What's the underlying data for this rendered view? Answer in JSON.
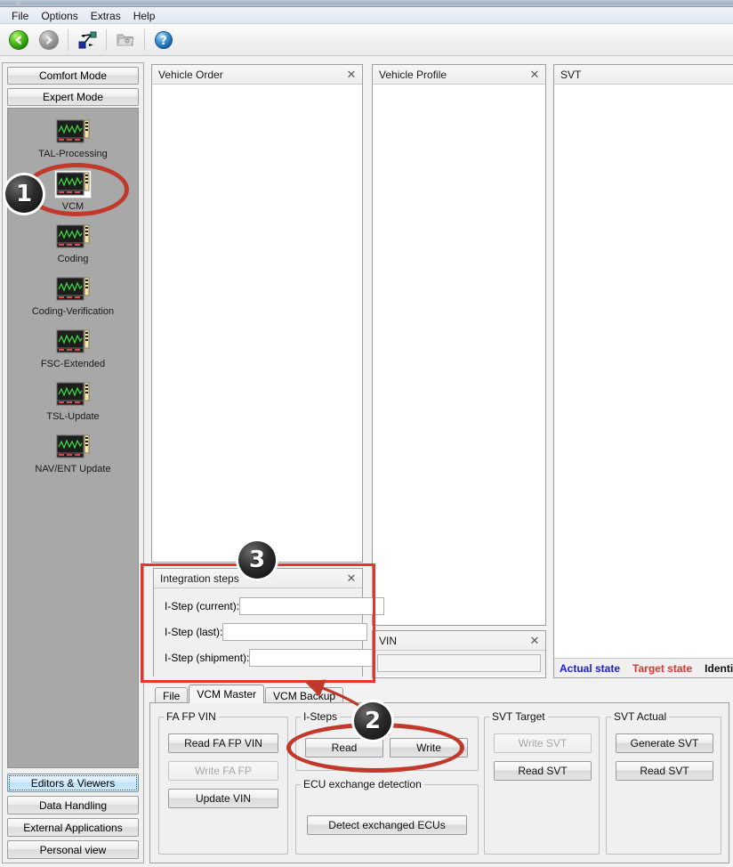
{
  "window": {
    "menu": [
      "File",
      "Options",
      "Extras",
      "Help"
    ],
    "toolbar": [
      {
        "name": "back-icon",
        "label": "Back",
        "enabled": true
      },
      {
        "name": "forward-icon",
        "label": "Forward",
        "enabled": false
      },
      {
        "name": "connection-icon",
        "label": "Connection",
        "enabled": true
      },
      {
        "name": "folder-icon",
        "label": "Open",
        "enabled": true
      },
      {
        "name": "help-icon",
        "label": "Help",
        "enabled": true
      }
    ]
  },
  "sidebar": {
    "mode_buttons": [
      {
        "label": "Comfort Mode"
      },
      {
        "label": "Expert Mode"
      }
    ],
    "items": [
      {
        "label": "TAL-Processing",
        "selected": false
      },
      {
        "label": "VCM",
        "selected": true
      },
      {
        "label": "Coding",
        "selected": false
      },
      {
        "label": "Coding-Verification",
        "selected": false
      },
      {
        "label": "FSC-Extended",
        "selected": false
      },
      {
        "label": "TSL-Update",
        "selected": false
      },
      {
        "label": "NAV/ENT Update",
        "selected": false
      }
    ],
    "bottom_buttons": [
      {
        "label": "Editors & Viewers",
        "focused": true
      },
      {
        "label": "Data Handling",
        "focused": false
      },
      {
        "label": "External Applications",
        "focused": false
      },
      {
        "label": "Personal view",
        "focused": false
      }
    ]
  },
  "panels": {
    "vehicle_order": {
      "title": "Vehicle Order",
      "close": "✕",
      "content": ""
    },
    "vehicle_profile": {
      "title": "Vehicle Profile",
      "close": "✕",
      "content": ""
    },
    "svt": {
      "title": "SVT",
      "close": "",
      "content": ""
    },
    "integration_steps": {
      "title": "Integration steps",
      "close": "✕",
      "rows": [
        {
          "label": "I-Step (current):",
          "value": "",
          "placeholder": ""
        },
        {
          "label": "I-Step (last):",
          "value": "",
          "placeholder": ""
        },
        {
          "label": "I-Step (shipment):",
          "value": "",
          "placeholder": ""
        }
      ]
    },
    "vin": {
      "title": "VIN",
      "close": "✕",
      "value": "",
      "placeholder": ""
    }
  },
  "legend": {
    "items": [
      {
        "label": "Actual state",
        "color": "#1a1aee"
      },
      {
        "label": "Target state",
        "color": "#e83030"
      },
      {
        "label": "Identica",
        "color": "#111111"
      }
    ]
  },
  "tabs": [
    {
      "label": "File",
      "active": false
    },
    {
      "label": "VCM Master",
      "active": true
    },
    {
      "label": "VCM Backup",
      "active": false
    }
  ],
  "vcm_master": {
    "groups": [
      {
        "legend": "FA FP VIN",
        "buttons": [
          {
            "label": "Read FA FP VIN",
            "disabled": false
          },
          {
            "label": "Write FA FP",
            "disabled": true
          },
          {
            "label": "Update VIN",
            "disabled": false
          }
        ]
      },
      {
        "legend": "I-Steps",
        "buttons": [
          {
            "label": "Read",
            "disabled": false
          },
          {
            "label": "Write",
            "disabled": false
          }
        ]
      },
      {
        "legend": "ECU exchange detection",
        "buttons": [
          {
            "label": "Detect exchanged ECUs",
            "disabled": false
          }
        ]
      },
      {
        "legend": "SVT Target",
        "buttons": [
          {
            "label": "Write SVT",
            "disabled": true
          },
          {
            "label": "Read SVT",
            "disabled": false
          }
        ]
      },
      {
        "legend": "SVT Actual",
        "buttons": [
          {
            "label": "Generate SVT",
            "disabled": false
          },
          {
            "label": "Read SVT",
            "disabled": false
          }
        ]
      }
    ]
  },
  "annotations": {
    "badges": [
      {
        "number": "1",
        "target": "vcm-sidebar-item"
      },
      {
        "number": "2",
        "target": "istep-read-button"
      },
      {
        "number": "3",
        "target": "integration-steps-panel"
      }
    ],
    "highlight_color": "#c0392b",
    "box_color": "#e8342a"
  }
}
